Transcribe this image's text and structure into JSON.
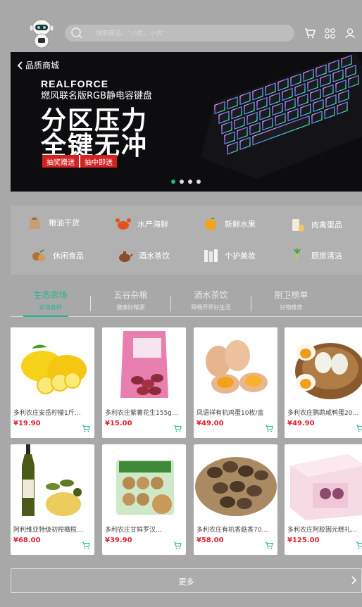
{
  "header": {
    "search_placeholder": "搜索商品，“小优，小优”",
    "icons": [
      "cart-icon",
      "grid-icon",
      "user-icon"
    ]
  },
  "banner": {
    "back_label": "品质商城",
    "brand": "REALFORCE",
    "subtitle": "燃风联名版RGB静电容键盘",
    "headline1": "分区压力",
    "headline2": "全键无冲",
    "tag1": "抽奖赠送",
    "tag2": "抽中即送",
    "slides": 4,
    "active_slide": 1
  },
  "categories": [
    {
      "label": "粮油干货",
      "icon": "grain-sack-icon"
    },
    {
      "label": "水产海鲜",
      "icon": "crab-icon"
    },
    {
      "label": "新鲜水果",
      "icon": "orange-icon"
    },
    {
      "label": "肉禽蛋品",
      "icon": "milk-egg-icon"
    },
    {
      "label": "休闲食品",
      "icon": "nuts-icon"
    },
    {
      "label": "酒水茶饮",
      "icon": "teapot-icon"
    },
    {
      "label": "个护美妆",
      "icon": "cosmetics-icon"
    },
    {
      "label": "厨房清洁",
      "icon": "vegetable-icon"
    }
  ],
  "tabs": [
    {
      "title": "生态农场",
      "subtitle": "农场直供",
      "active": true
    },
    {
      "title": "五谷杂粮",
      "subtitle": "健康好粮源",
      "active": false
    },
    {
      "title": "酒水茶饮",
      "subtitle": "颐畅开怀好生活",
      "active": false
    },
    {
      "title": "厨卫榜单",
      "subtitle": "好物推荐",
      "active": false
    }
  ],
  "products": [
    {
      "name": "多利农庄安岳柠檬1斤…",
      "price": "¥19.90",
      "image": "lemons"
    },
    {
      "name": "多利农庄紫薯花生155g…",
      "price": "¥15.00",
      "image": "peanuts"
    },
    {
      "name": "凤语祥有机鸡蛋10枚/盒",
      "price": "¥49.00",
      "image": "eggs"
    },
    {
      "name": "多利农庄鹦鹉咸鸭蛋20…",
      "price": "¥49.90",
      "image": "duck-eggs"
    },
    {
      "name": "阿利维亚特级初榨橄榄…",
      "price": "¥68.00",
      "image": "olive-oil"
    },
    {
      "name": "多利农庄甘鲜罗汉…",
      "price": "¥39.90",
      "image": "monk-fruit"
    },
    {
      "name": "多利农庄有机香菇香70…",
      "price": "¥58.00",
      "image": "mushrooms"
    },
    {
      "name": "多利农庄阿胶固元糕礼…",
      "price": "¥125.00",
      "image": "gift-box"
    }
  ],
  "more_label": "更多",
  "colors": {
    "accent": "#1fb88d",
    "price": "#e01f2f",
    "banner_tag": "#d42222"
  }
}
